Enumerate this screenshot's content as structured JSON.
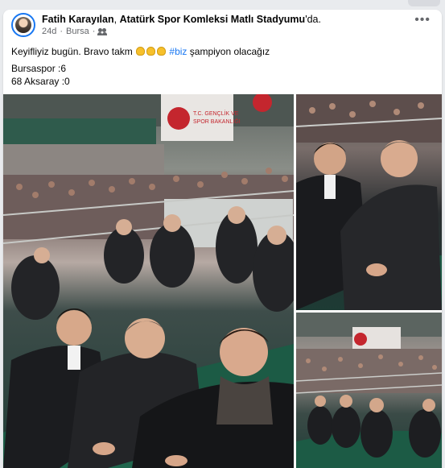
{
  "post": {
    "author": "Fatih Karayılan",
    "separator": ", ",
    "location": "Atatürk Spor Komleksi Matlı Stadyumu",
    "location_suffix": "'da.",
    "time": "24d",
    "dot": "·",
    "place": "Bursa",
    "audience_icon": "friends-icon",
    "more_icon": "more-options-icon",
    "text_before": "Keyifliyiz bugün. Bravo takm ",
    "emoji": "clapping-hands",
    "hashtag": "#biz",
    "text_after": " şampiyon olacağız",
    "score_line_1": "Bursaspor :6",
    "score_line_2": "68 Aksaray :0"
  },
  "banner": {
    "line1": "T.C. GENÇLİK VE",
    "line2": "SPOR BAKANLIĞI"
  },
  "colors": {
    "accent": "#1877f2",
    "seat_green": "#1c5b45",
    "banner_red": "#c4262e"
  }
}
